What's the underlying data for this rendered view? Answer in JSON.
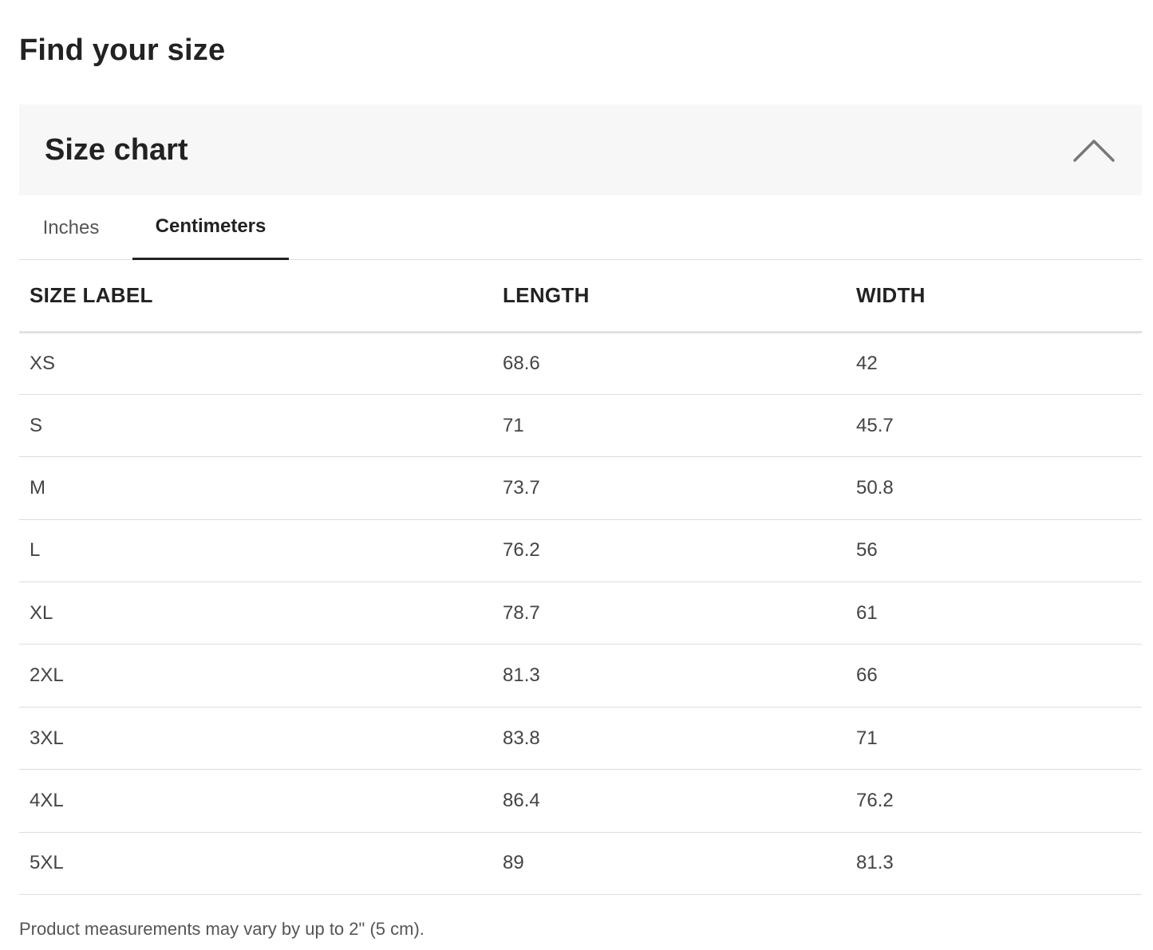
{
  "page_title": "Find your size",
  "accordion": {
    "title": "Size chart",
    "icon": "chevron-up-icon"
  },
  "tabs": [
    {
      "label": "Inches",
      "active": false
    },
    {
      "label": "Centimeters",
      "active": true
    }
  ],
  "table": {
    "headers": [
      "SIZE LABEL",
      "LENGTH",
      "WIDTH"
    ],
    "rows": [
      [
        "XS",
        "68.6",
        "42"
      ],
      [
        "S",
        "71",
        "45.7"
      ],
      [
        "M",
        "73.7",
        "50.8"
      ],
      [
        "L",
        "76.2",
        "56"
      ],
      [
        "XL",
        "78.7",
        "61"
      ],
      [
        "2XL",
        "81.3",
        "66"
      ],
      [
        "3XL",
        "83.8",
        "71"
      ],
      [
        "4XL",
        "86.4",
        "76.2"
      ],
      [
        "5XL",
        "89",
        "81.3"
      ]
    ]
  },
  "footnote": "Product measurements may vary by up to 2\" (5 cm).",
  "colors": {
    "header_bg": "#f7f7f7",
    "text_primary": "#222222",
    "text_secondary": "#555555",
    "divider": "#dddddd"
  }
}
